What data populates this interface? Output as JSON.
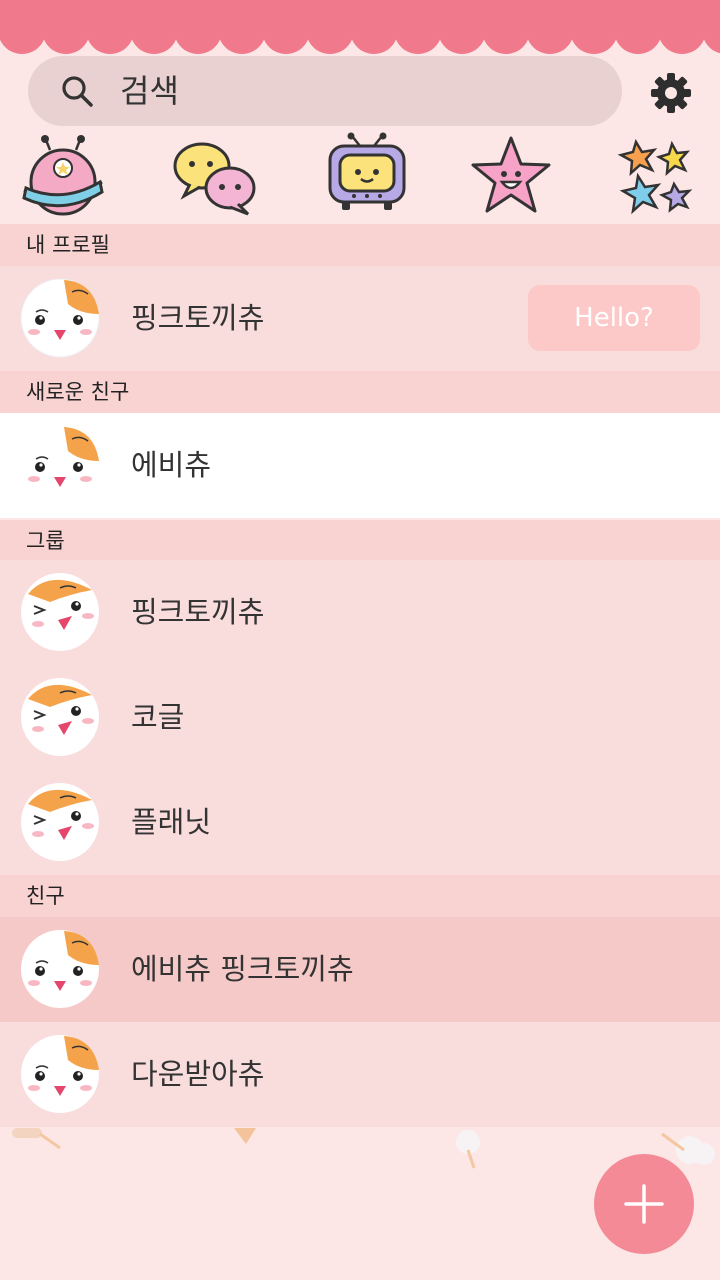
{
  "search": {
    "label": "검색"
  },
  "categories": [
    {
      "icon": "planet-icon"
    },
    {
      "icon": "chat-bubbles-icon"
    },
    {
      "icon": "tv-icon"
    },
    {
      "icon": "star-icon"
    },
    {
      "icon": "flowers-icon"
    }
  ],
  "sections": {
    "my_profile": "내 프로필",
    "new_friends": "새로운 친구",
    "groups": "그룹",
    "friends": "친구"
  },
  "my_profile": {
    "name": "핑크토끼츄",
    "status_button": "Hello?"
  },
  "new_friends": [
    {
      "name": "에비츄"
    }
  ],
  "groups": [
    {
      "name": "핑크토끼츄"
    },
    {
      "name": "코글"
    },
    {
      "name": "플래닛"
    }
  ],
  "friends": [
    {
      "name": "에비츄 핑크토끼츄"
    },
    {
      "name": "다운받아츄"
    }
  ],
  "colors": {
    "banner": "#f07a8c",
    "background": "#fde6e6",
    "section": "#f9d2d2",
    "row": "#f9dddd",
    "highlight_row": "#f6c9c9",
    "accent": "#f38a95"
  },
  "fab": {
    "icon": "plus-icon"
  }
}
